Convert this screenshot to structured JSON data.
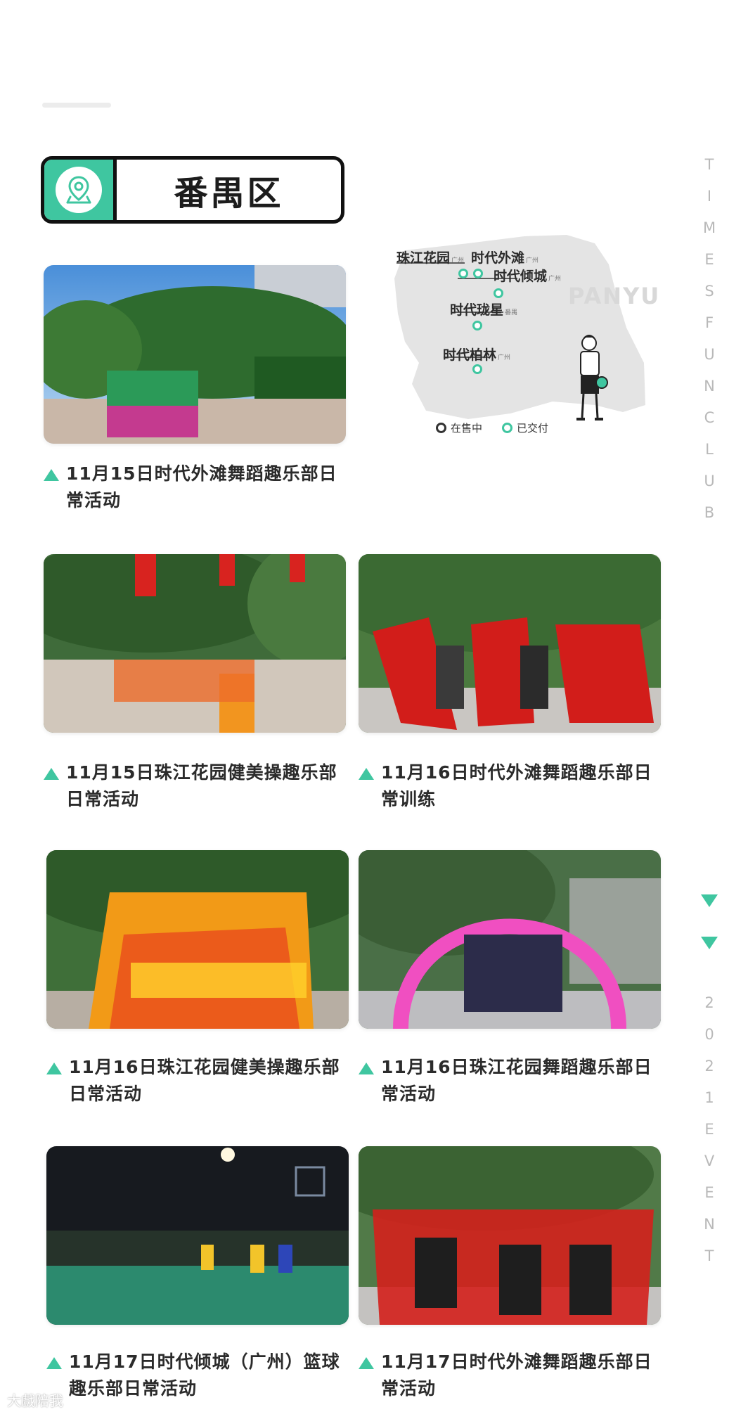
{
  "district": {
    "title": "番禺区",
    "icon": "location-pin-icon"
  },
  "side_text_top": [
    "T",
    "I",
    "M",
    "E",
    "S",
    "F",
    "U",
    "N",
    "C",
    "L",
    "U",
    "B"
  ],
  "side_text_bottom": [
    "2",
    "0",
    "2",
    "1",
    "E",
    "V",
    "E",
    "N",
    "T"
  ],
  "map": {
    "panyu_label": "PANYU",
    "labels": [
      {
        "name": "珠江花园",
        "sub": "广州"
      },
      {
        "name": "时代外滩",
        "sub": "广州"
      },
      {
        "name": "时代倾城",
        "sub": "广州"
      },
      {
        "name": "时代珑星",
        "sub": "番禺"
      },
      {
        "name": "时代柏林",
        "sub": "广州"
      }
    ],
    "legend": {
      "on_sale": "在售中",
      "delivered": "已交付"
    },
    "colors": {
      "accent": "#3fc6a0",
      "land": "#e4e4e4"
    }
  },
  "activities": [
    {
      "caption": "11月15日时代外滩舞蹈趣乐部日常活动"
    },
    {
      "caption": "11月15日珠江花园健美操趣乐部日常活动"
    },
    {
      "caption": "11月16日时代外滩舞蹈趣乐部日常训练"
    },
    {
      "caption": "11月16日珠江花园健美操趣乐部日常活动"
    },
    {
      "caption": "11月16日珠江花园舞蹈趣乐部日常活动"
    },
    {
      "caption": "11月17日时代倾城（广州）篮球趣乐部日常活动"
    },
    {
      "caption": "11月17日时代外滩舞蹈趣乐部日常活动"
    }
  ],
  "watermark": "大戲陪我"
}
